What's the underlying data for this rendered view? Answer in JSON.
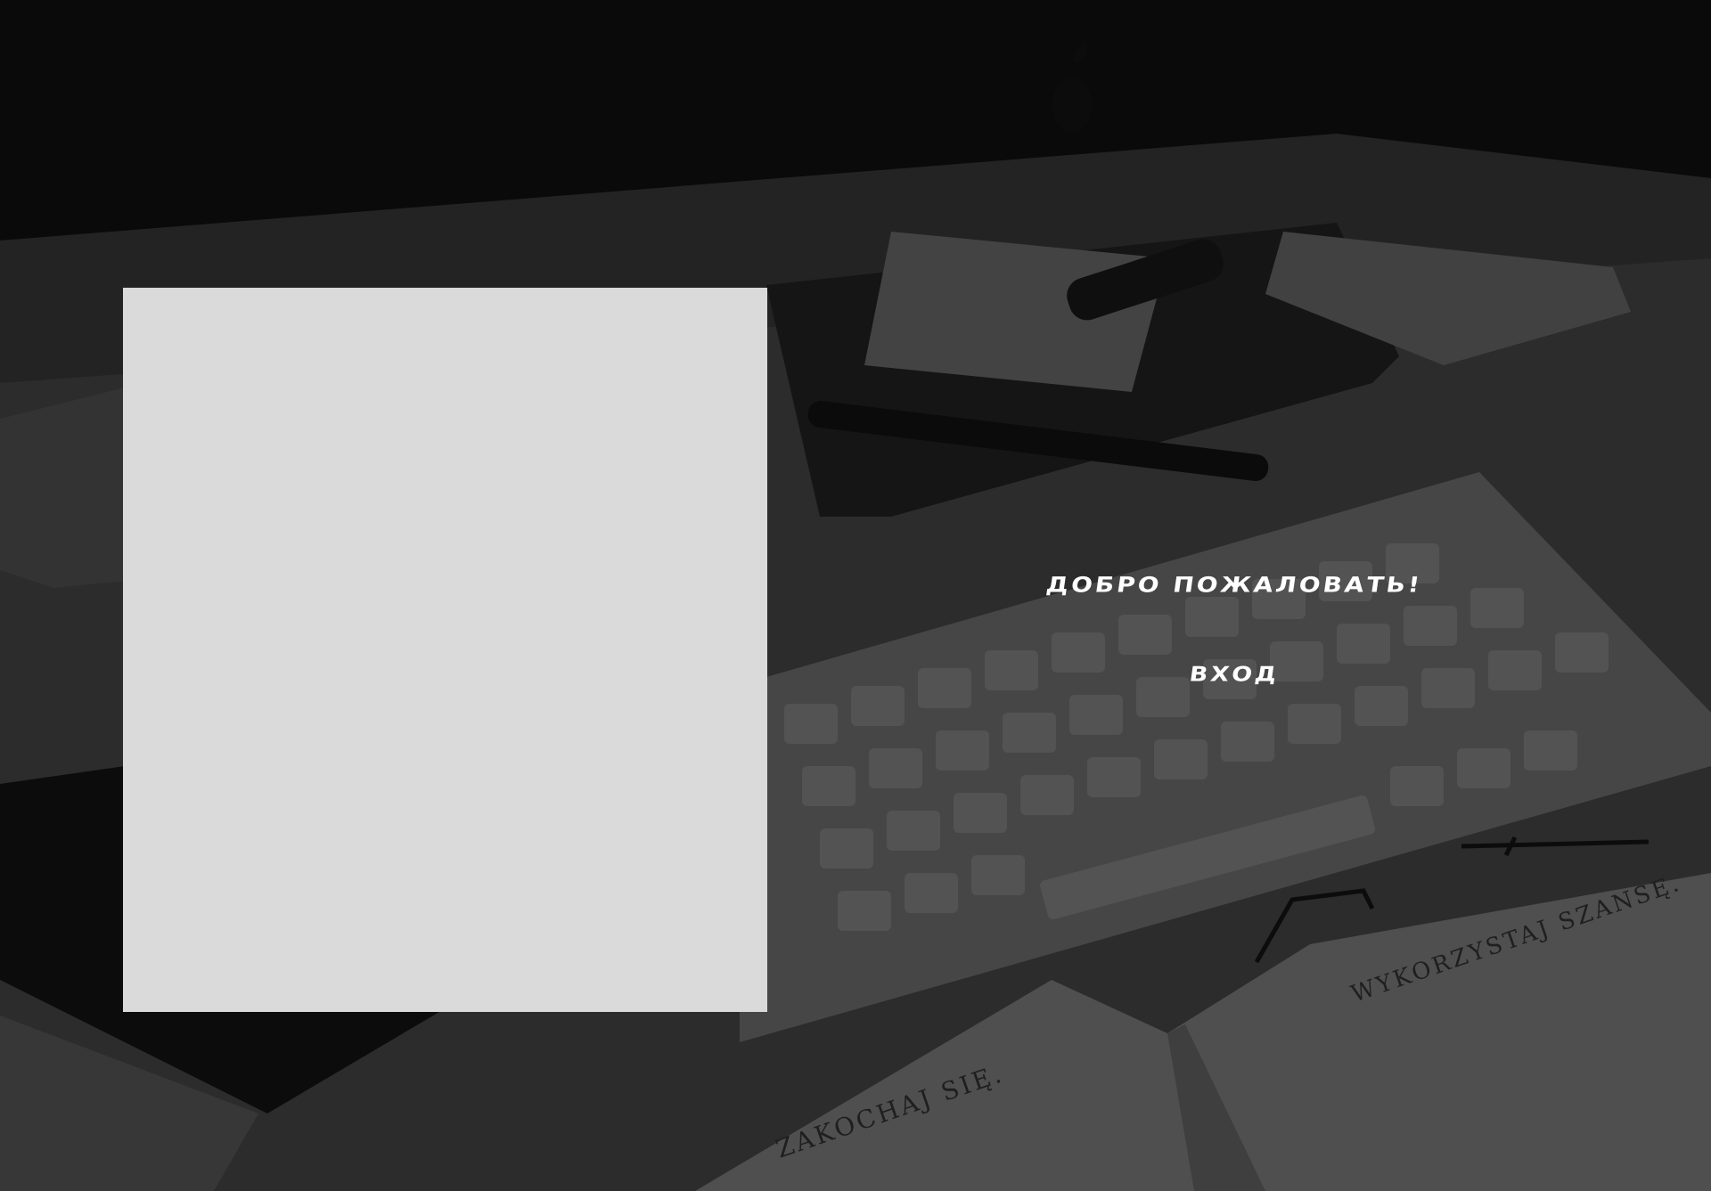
{
  "hero": {
    "welcome_text": "ДОБРО ПОЖАЛОВАТЬ!",
    "login_label": "ВХОД"
  },
  "background": {
    "book_right_heading": "WYKORZYSTAJ SZANSĘ.",
    "book_left_heading": "ZAKOCHAJ SIĘ."
  },
  "colors": {
    "panel": "#dadada",
    "text": "#ffffff",
    "backdrop": "#1a1a1a"
  }
}
